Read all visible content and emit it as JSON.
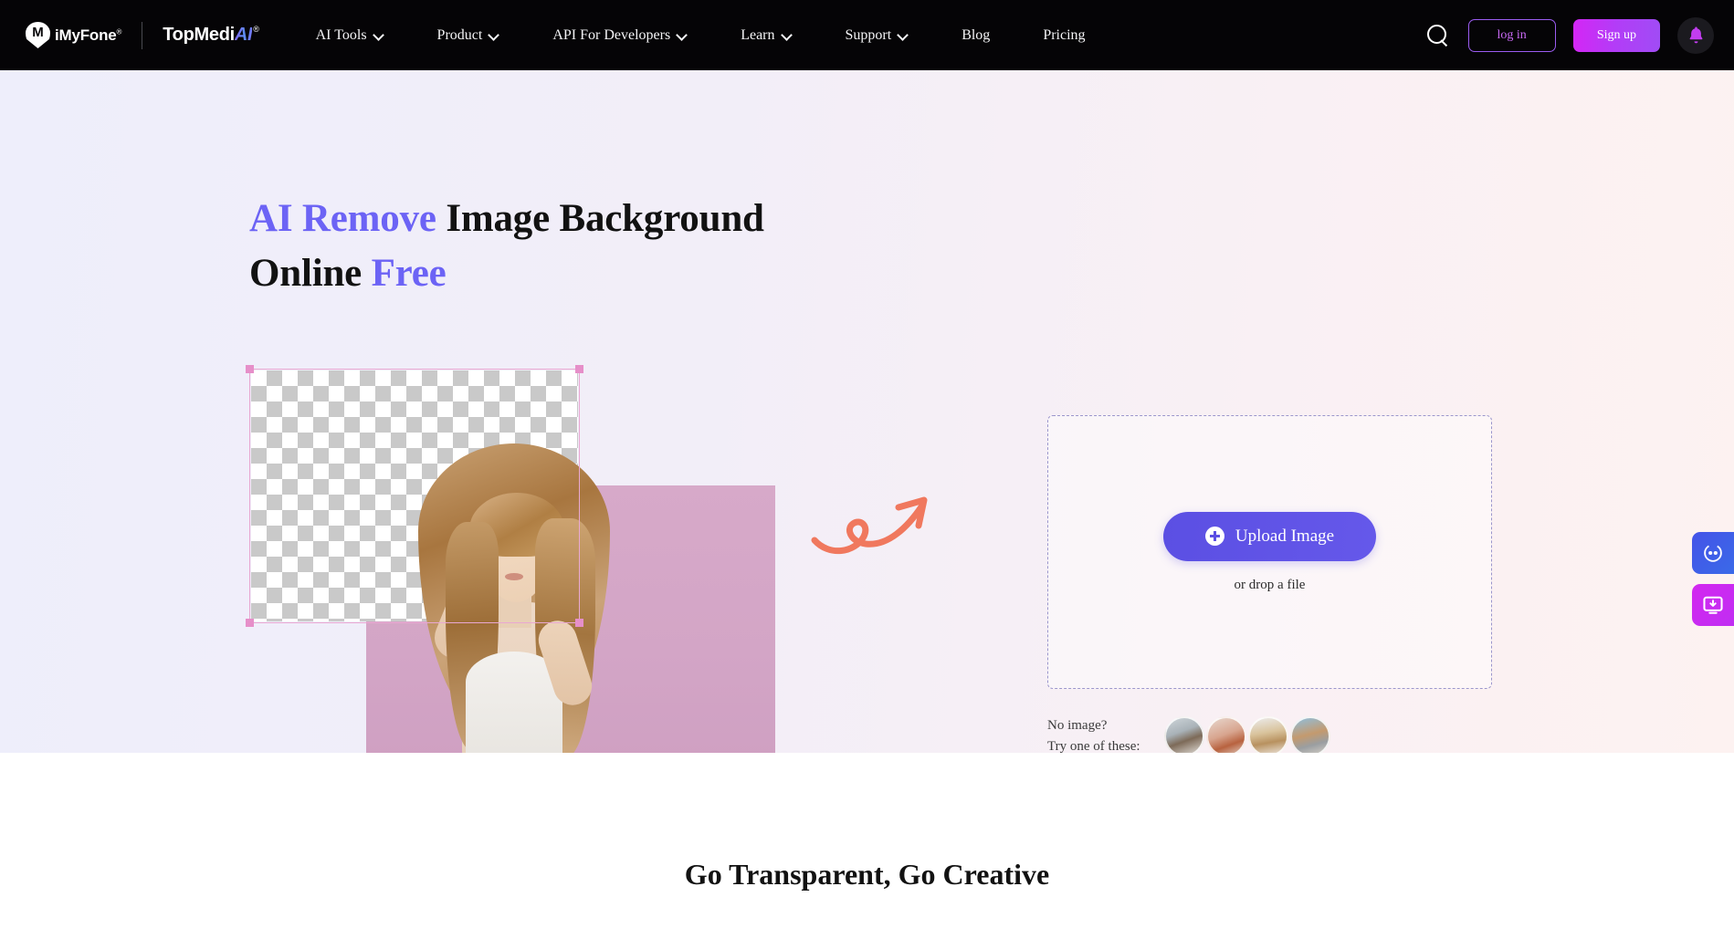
{
  "nav": {
    "brand_primary": "iMyFone",
    "brand_primary_sup": "®",
    "brand_secondary_a": "TopMedi",
    "brand_secondary_b": "AI",
    "brand_secondary_sup": "®",
    "links": [
      {
        "label": "AI Tools",
        "has_caret": true
      },
      {
        "label": "Product",
        "has_caret": true
      },
      {
        "label": "API For Developers",
        "has_caret": true
      },
      {
        "label": "Learn",
        "has_caret": true
      },
      {
        "label": "Support",
        "has_caret": true
      },
      {
        "label": "Blog",
        "has_caret": false
      },
      {
        "label": "Pricing",
        "has_caret": false
      }
    ],
    "search_icon": "search-icon",
    "login_label": "log in",
    "signup_label": "Sign up",
    "bell_icon": "bell-icon"
  },
  "hero": {
    "title_line1_accent": "AI Remove",
    "title_line1_rest": " Image Background",
    "title_line2_rest": "Online ",
    "title_line2_accent": "Free",
    "artwork": {
      "checker_label": "transparent-checkerboard",
      "selection_label": "selection-box",
      "subject_label": "woman-with-long-hair-photo",
      "backdrop_label": "pink-backdrop"
    },
    "arrow_label": "curly-arrow-pointing-to-upload"
  },
  "upload": {
    "button_label": "Upload Image",
    "drop_text": "or drop a file",
    "plus_icon": "plus-circle-icon"
  },
  "samples": {
    "line1": "No image?",
    "line2": "Try one of these:",
    "thumbs": [
      {
        "name": "sample-man-with-car"
      },
      {
        "name": "sample-perfume-bottle"
      },
      {
        "name": "sample-hamster"
      },
      {
        "name": "sample-white-suv"
      }
    ]
  },
  "side_tabs": [
    {
      "name": "chat-support-tab",
      "icon": "chat-bubble-icon"
    },
    {
      "name": "download-app-tab",
      "icon": "download-monitor-icon"
    }
  ],
  "lower": {
    "title": "Go Transparent, Go Creative"
  },
  "colors": {
    "accent_purple": "#6c63f5",
    "upload_purple": "#5b4fe3",
    "signup_magenta": "#c02ef2",
    "arrow_coral": "#f0785e",
    "nav_black": "#050406",
    "pink_backdrop": "#d3a5c6",
    "handle_pink": "#e68fc9"
  }
}
